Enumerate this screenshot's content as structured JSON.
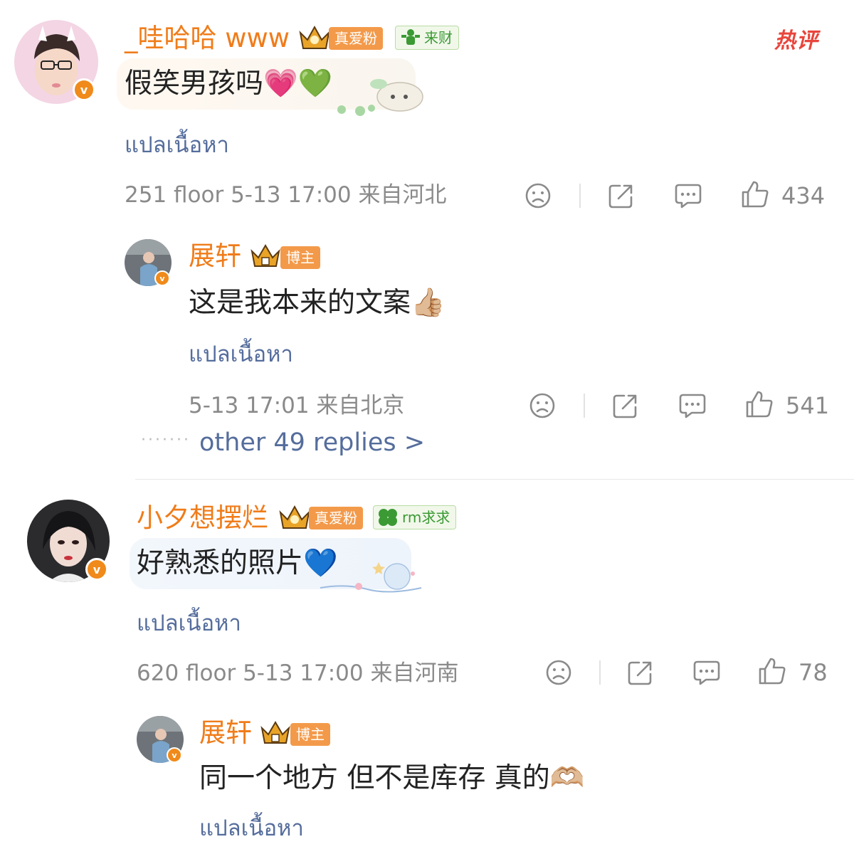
{
  "hot_label": "热评",
  "comments": [
    {
      "username": "_哇哈哈 www",
      "fan_tag": "真爱粉",
      "extra_tag": "来财",
      "text": "假笑男孩吗💗💚",
      "translate": "แปลเนื้อหา",
      "meta": "251 floor 5-13 17:00 来自河北",
      "likes": "434",
      "reply": {
        "username": "展轩",
        "role_tag": "博主",
        "text": "这是我本来的文案👍🏼",
        "translate": "แปลเนื้อหา",
        "meta": "5-13 17:01 来自北京",
        "likes": "541"
      },
      "more_replies": "other 49 replies >"
    },
    {
      "username": "小夕想摆烂",
      "fan_tag": "真爱粉",
      "extra_tag": "rm求求",
      "text": "好熟悉的照片💙",
      "translate": "แปลเนื้อหา",
      "meta": "620 floor 5-13 17:00 来自河南",
      "likes": "78",
      "reply": {
        "username": "展轩",
        "role_tag": "博主",
        "text": "同一个地方 但不是库存 真的🫶🏼",
        "translate": "แปลเนื้อหา"
      }
    }
  ],
  "icons": {
    "dislike": "sad-face-icon",
    "share": "share-icon",
    "reply": "comment-bubble-icon",
    "like": "thumbs-up-icon",
    "verified": "verified-v-badge-icon",
    "crown": "crown-icon"
  },
  "colors": {
    "username": "#f07c1a",
    "link": "#556d9c",
    "meta": "#8a8a8a",
    "hot": "#e8453c",
    "fan_tag_bg": "#f39a4a",
    "green_tag_text": "#3b9a34"
  }
}
